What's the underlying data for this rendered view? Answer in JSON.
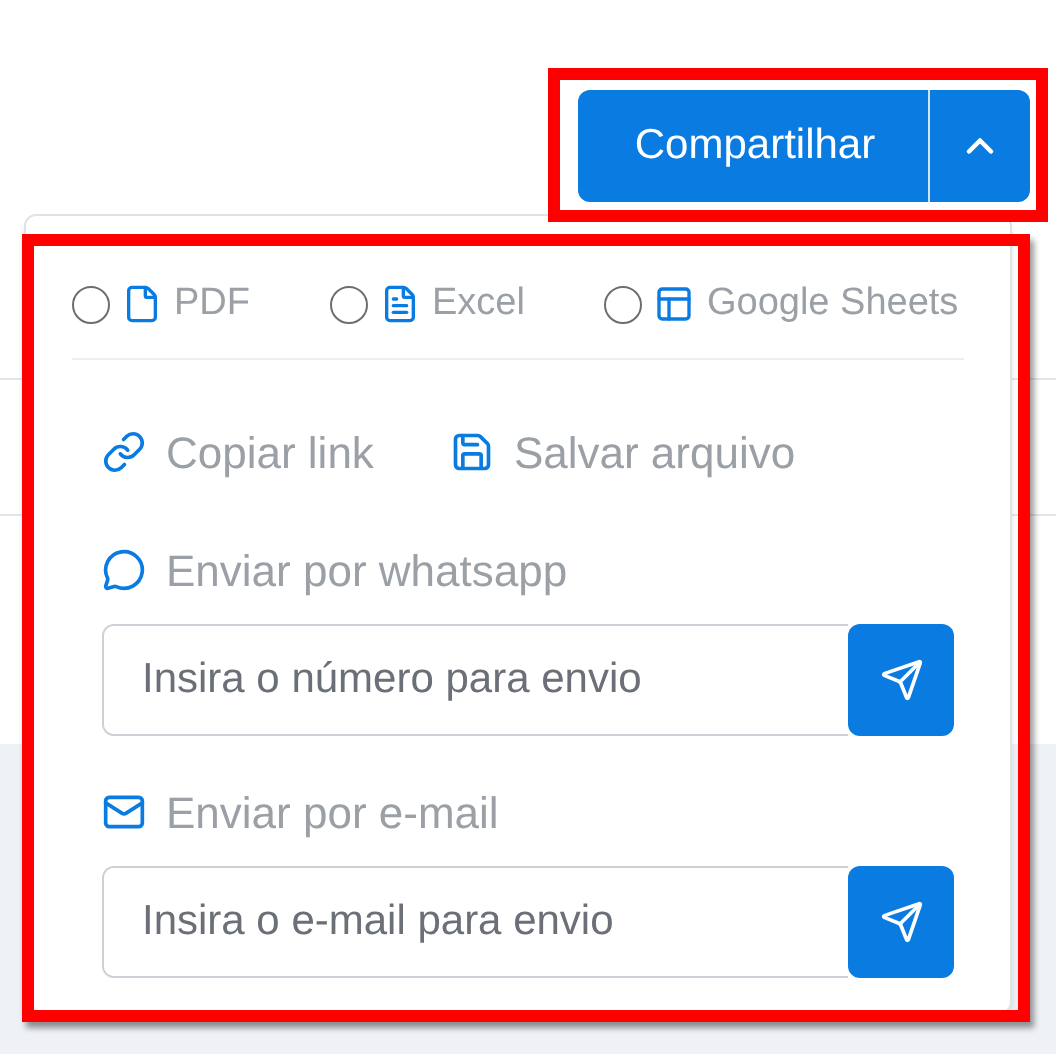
{
  "share_button": {
    "label": "Compartilhar",
    "expanded": true
  },
  "formats": [
    {
      "kind": "pdf",
      "label": "PDF",
      "selected": false
    },
    {
      "kind": "excel",
      "label": "Excel",
      "selected": false
    },
    {
      "kind": "sheets",
      "label": "Google Sheets",
      "selected": false
    }
  ],
  "actions": [
    {
      "kind": "link",
      "label": "Copiar link"
    },
    {
      "kind": "save",
      "label": "Salvar arquivo"
    }
  ],
  "send": [
    {
      "kind": "whatsapp",
      "label": "Enviar por whatsapp",
      "placeholder": "Insira o número para envio"
    },
    {
      "kind": "email",
      "label": "Enviar por e-mail",
      "placeholder": "Insira o e-mail para envio"
    }
  ]
}
